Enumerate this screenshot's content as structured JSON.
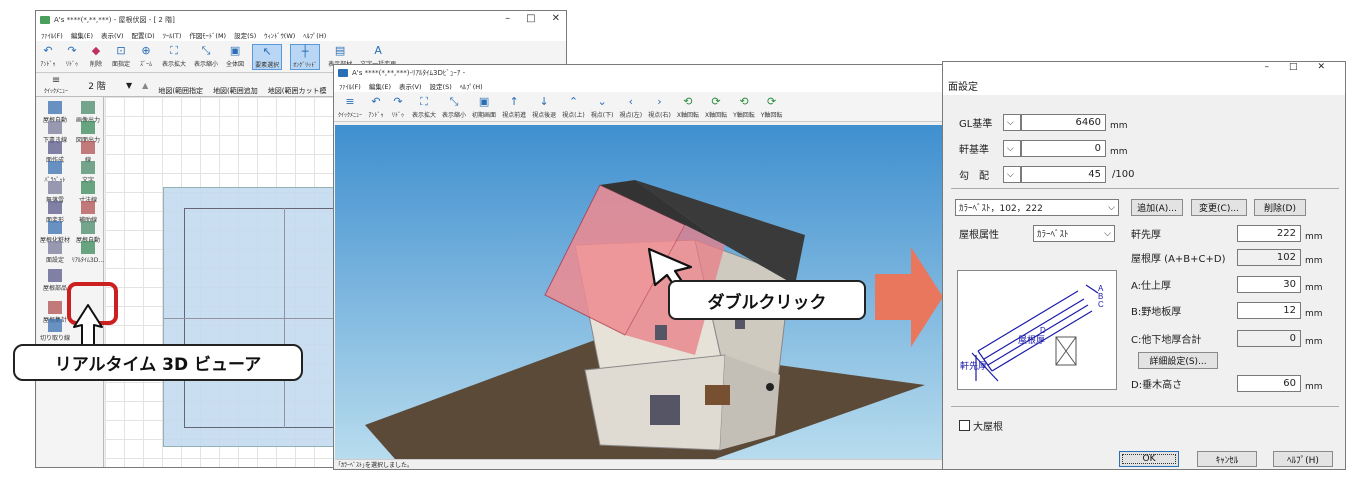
{
  "main_window": {
    "title": "A's ****(*,**,***) - 屋根伏図 - [ 2 階]",
    "menu": [
      "ﾌｧｲﾙ(F)",
      "編集(E)",
      "表示(V)",
      "配置(D)",
      "ﾂｰﾙ(T)",
      "作図ﾓｰﾄﾞ(M)",
      "設定(S)",
      "ｳｨﾝﾄﾞｳ(W)",
      "ﾍﾙﾌﾟ(H)"
    ],
    "toolbar": [
      "ｱﾝﾄﾞｩ",
      "ﾘﾄﾞｩ",
      "削除",
      "面指定",
      "ｽﾞｰﾑ",
      "表示拡大",
      "表示縮小",
      "全体図",
      "要素選択",
      "ｵﾝｸﾞﾘｯﾄﾞ",
      "表示部材",
      "文字一括変更"
    ],
    "toolbar2": {
      "quick_menu": "ｸｲｯｸﾒﾆｭｰ",
      "floor": "2 階",
      "map_range_specify": "地図(範囲指定",
      "map_range_add": "地図(範囲追加",
      "map_range_cut": "地図(範囲カット模"
    },
    "sidebar": [
      {
        "label": "屋根自動",
        "icon": "roof-auto-icon"
      },
      {
        "label": "画像出力",
        "icon": "image-output-icon"
      },
      {
        "label": "下書き線",
        "icon": "draft-line-icon"
      },
      {
        "label": "図面出力",
        "icon": "drawing-output-icon"
      },
      {
        "label": "面作成",
        "icon": "surface-create-icon"
      },
      {
        "label": "線",
        "icon": "line-icon"
      },
      {
        "label": "ﾊﾟﾗﾍﾟｯﾄ",
        "icon": "parapet-icon"
      },
      {
        "label": "文字",
        "icon": "text-icon"
      },
      {
        "label": "無落雪",
        "icon": "no-snow-icon"
      },
      {
        "label": "寸法線",
        "icon": "dimension-icon"
      },
      {
        "label": "面変形",
        "icon": "surface-transform-icon"
      },
      {
        "label": "補助線",
        "icon": "aux-line-icon"
      },
      {
        "label": "屋根化粧材",
        "icon": "roof-trim-icon"
      },
      {
        "label": "屋根自動",
        "icon": "roof-auto2-icon"
      },
      {
        "label": "面設定",
        "icon": "surface-settings-icon"
      },
      {
        "label": "ﾘｱﾙﾀｲﾑ3D...",
        "icon": "realtime-3d-icon"
      },
      {
        "label": "屋根部品",
        "icon": "roof-parts-icon"
      },
      {
        "label": "屋根集計",
        "icon": "roof-summary-icon"
      },
      {
        "label": "切り取り線",
        "icon": "cut-line-icon"
      }
    ]
  },
  "viewer": {
    "title": "A's ****(*,**,***)-ﾘｱﾙﾀｲﾑ3Dﾋﾞｭｰｱ -",
    "menu": [
      "ﾌｧｲﾙ(F)",
      "編集(E)",
      "表示(V)",
      "設定(S)",
      "ﾍﾙﾌﾟ(H)"
    ],
    "toolbar": [
      "ｸｲｯｸﾒﾆｭｰ",
      "ｱﾝﾄﾞｩ",
      "ﾘﾄﾞｩ",
      "表示拡大",
      "表示縮小",
      "初期画面",
      "視点前進",
      "視点後退",
      "視点(上)",
      "視点(下)",
      "視点(左)",
      "視点(右)",
      "X軸回転",
      "X軸回転",
      "Y軸回転",
      "Y軸回転"
    ],
    "status": "｢ｶﾗｰﾍﾞｽﾄ｣を選択しました。"
  },
  "callouts": {
    "viewer_label": "リアルタイム 3D ビューア",
    "double_click": "ダブルクリック"
  },
  "dialog": {
    "title": "面設定",
    "gl_label": "GL基準",
    "gl_value": "6460",
    "gl_unit": "mm",
    "eave_label": "軒基準",
    "eave_value": "0",
    "eave_unit": "mm",
    "slope_label": "勾　配",
    "slope_value": "45",
    "slope_unit": "/100",
    "material_select": "ｶﾗｰﾍﾞｽﾄ，102，222",
    "add_button": "追加(A)...",
    "change_button": "変更(C)...",
    "delete_button": "削除(D)",
    "roof_attr_label": "屋根属性",
    "roof_attr_value": "ｶﾗｰﾍﾞｽﾄ",
    "fields": [
      {
        "label": "軒先厚",
        "value": "222",
        "unit": "mm",
        "editable": true
      },
      {
        "label": "屋根厚 (A+B+C+D)",
        "value": "102",
        "unit": "mm",
        "editable": false
      },
      {
        "label": "A:仕上厚",
        "value": "30",
        "unit": "mm",
        "editable": true
      },
      {
        "label": "B:野地板厚",
        "value": "12",
        "unit": "mm",
        "editable": true
      },
      {
        "label": "C:他下地厚合計",
        "value": "0",
        "unit": "mm",
        "editable": false
      },
      {
        "label": "D:垂木高さ",
        "value": "60",
        "unit": "mm",
        "editable": true
      }
    ],
    "detail_button": "詳細設定(S)...",
    "diagram": {
      "roof_thickness": "屋根厚",
      "eave_thickness": "軒先厚",
      "a": "A",
      "b": "B",
      "c": "C",
      "d": "D"
    },
    "big_roof_label": "大屋根",
    "ok": "OK",
    "cancel": "ｷｬﾝｾﾙ",
    "help": "ﾍﾙﾌﾟ(H)"
  },
  "colors": {
    "highlight": "#cc1f1f",
    "arrow": "#e8775e",
    "accent": "#2a6fb6"
  }
}
